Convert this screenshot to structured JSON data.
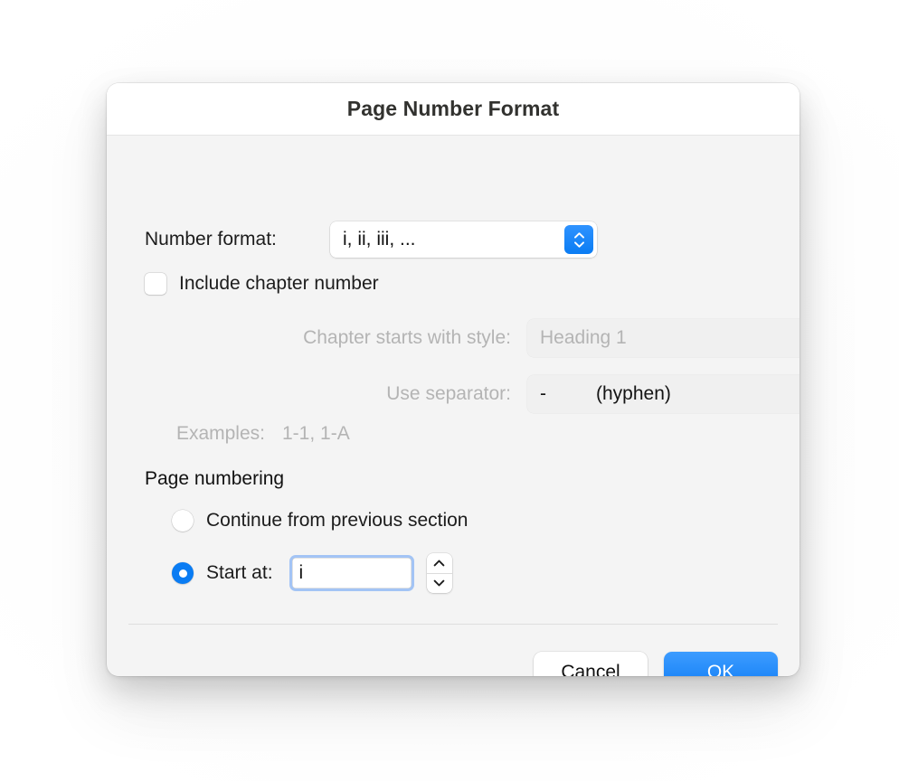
{
  "dialog": {
    "title": "Page Number Format"
  },
  "number_format": {
    "label": "Number format:",
    "value": "i, ii, iii, ...",
    "chevron_icon": "chevron-up-down-icon"
  },
  "include_chapter": {
    "label": "Include chapter number",
    "checked": false
  },
  "chapter_style": {
    "label": "Chapter starts with style:",
    "value": "Heading 1",
    "disabled": true,
    "chevron_icon": "chevron-up-down-icon"
  },
  "separator": {
    "label": "Use separator:",
    "value_symbol": "-",
    "value_name": "(hyphen)",
    "disabled": true,
    "chevron_icon": "chevron-up-down-icon"
  },
  "examples": {
    "label": "Examples:",
    "value": "1-1, 1-A"
  },
  "page_numbering": {
    "heading": "Page numbering",
    "continue_option": {
      "label": "Continue from previous section",
      "selected": false
    },
    "start_at_option": {
      "label": "Start at:",
      "selected": true,
      "value": "i",
      "stepper_up_icon": "chevron-up-icon",
      "stepper_down_icon": "chevron-down-icon"
    }
  },
  "footer": {
    "cancel_label": "Cancel",
    "ok_label": "OK"
  },
  "colors": {
    "accent_blue": "#0a7cf3",
    "ok_button_top": "#3d9cff",
    "ok_button_bottom": "#0d7bf4",
    "focus_ring": "#6fa3f5",
    "dialog_body": "#f4f4f4",
    "titlebar": "#ffffff",
    "disabled_text": "#b4b4b4"
  }
}
